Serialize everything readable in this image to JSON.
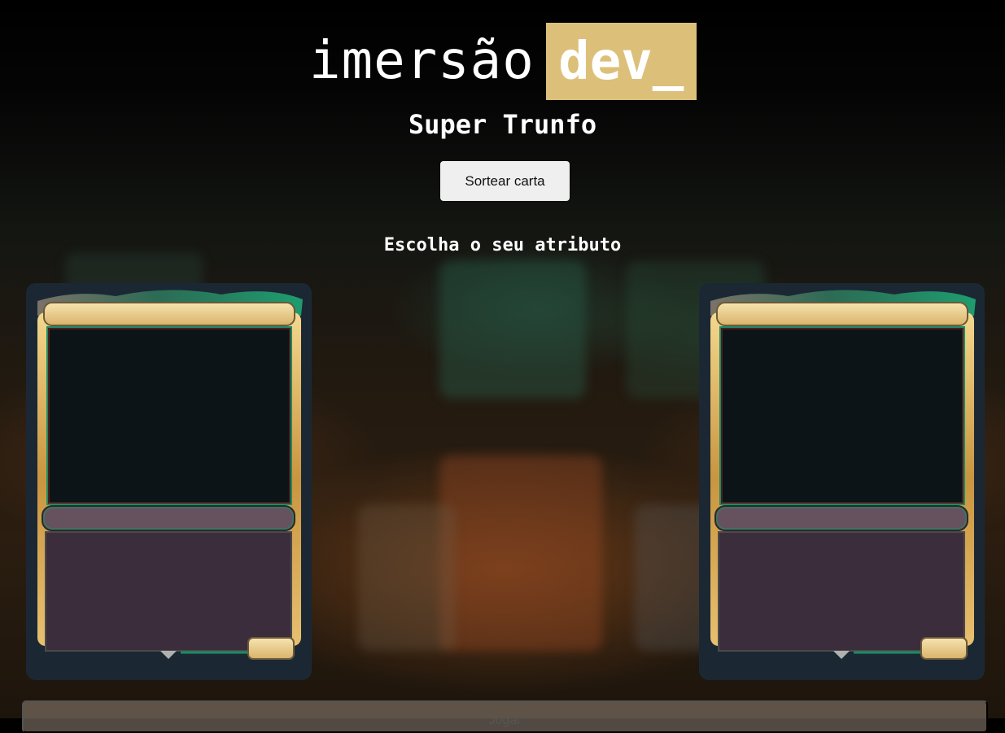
{
  "logo": {
    "text_light": "imersão",
    "text_bold": "dev_",
    "box_color": "#dcc07a"
  },
  "title": "Super Trunfo",
  "draw_button": {
    "label": "Sortear carta"
  },
  "attribute_prompt": "Escolha o seu atributo",
  "cards": [
    {
      "id": "player-card",
      "frame": "gold-green",
      "name": "",
      "type_line": "",
      "text": ""
    },
    {
      "id": "machine-card",
      "frame": "gold-green",
      "name": "",
      "type_line": "",
      "text": ""
    }
  ],
  "play_button": {
    "label": "Jogar"
  },
  "colors": {
    "card_background": "#1b2834",
    "frame_gold": "#d9b45a",
    "frame_green": "#1e8c64",
    "type_bar": "#66525f",
    "text_box": "#3c2d3c"
  }
}
